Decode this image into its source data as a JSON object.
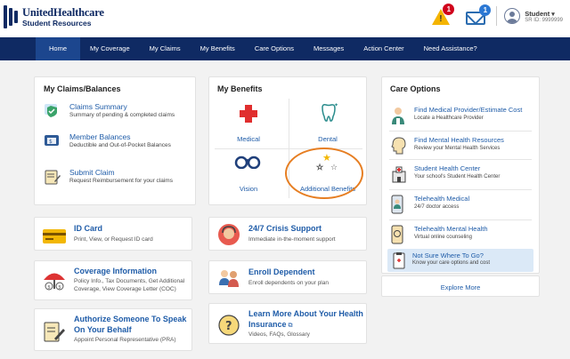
{
  "header": {
    "brand_line1": "UnitedHealthcare",
    "brand_line2": "Student Resources",
    "alerts_count": "1",
    "messages_count": "1",
    "user_name": "Student",
    "user_id": "SR ID: 9999999"
  },
  "nav": {
    "items": [
      "Home",
      "My Coverage",
      "My Claims",
      "My Benefits",
      "Care Options",
      "Messages",
      "Action Center",
      "Need Assistance?"
    ]
  },
  "claims": {
    "title": "My Claims/Balances",
    "items": [
      {
        "title": "Claims Summary",
        "sub": "Summary of pending & completed claims"
      },
      {
        "title": "Member Balances",
        "sub": "Deductible and Out-of-Pocket Balances"
      },
      {
        "title": "Submit Claim",
        "sub": "Request Reimbursement for your claims"
      }
    ]
  },
  "benefits": {
    "title": "My Benefits",
    "items": [
      "Medical",
      "Dental",
      "Vision",
      "Additional Benefits"
    ]
  },
  "tiles": {
    "id_card": {
      "title": "ID Card",
      "sub": "Print, View, or Request ID card"
    },
    "coverage": {
      "title": "Coverage Information",
      "sub": "Policy Info., Tax Documents, Get Additional Coverage, View Coverage Letter (COC)"
    },
    "authorize": {
      "title1": "Authorize Someone To Speak",
      "title2": "On Your Behalf",
      "sub": "Appoint Personal Representative (PRA)"
    },
    "crisis": {
      "title": "24/7 Crisis Support",
      "sub": "Immediate in-the-moment support"
    },
    "enroll": {
      "title": "Enroll Dependent",
      "sub": "Enroll dependents on your plan"
    },
    "learn": {
      "title1": "Learn More About Your Health",
      "title2": "Insurance",
      "sub": "Videos, FAQs, Glossary"
    }
  },
  "care": {
    "title": "Care Options",
    "items": [
      {
        "title": "Find Medical Provider/Estimate Cost",
        "sub": "Locate a Healthcare Provider"
      },
      {
        "title": "Find Mental Health Resources",
        "sub": "Review your Mental Health Services"
      },
      {
        "title": "Student Health Center",
        "sub": "Your school's Student Health Center"
      },
      {
        "title": "Telehealth Medical",
        "sub": "24/7 doctor access"
      },
      {
        "title": "Telehealth Mental Health",
        "sub": "Virtual online counseling"
      },
      {
        "title": "Not Sure Where To Go?",
        "sub": "Know your care options and cost"
      }
    ],
    "explore_label": "Explore More"
  },
  "colors": {
    "nav_bg": "#0f2a63",
    "link": "#1f5ca8",
    "annotation": "#e67e22"
  }
}
